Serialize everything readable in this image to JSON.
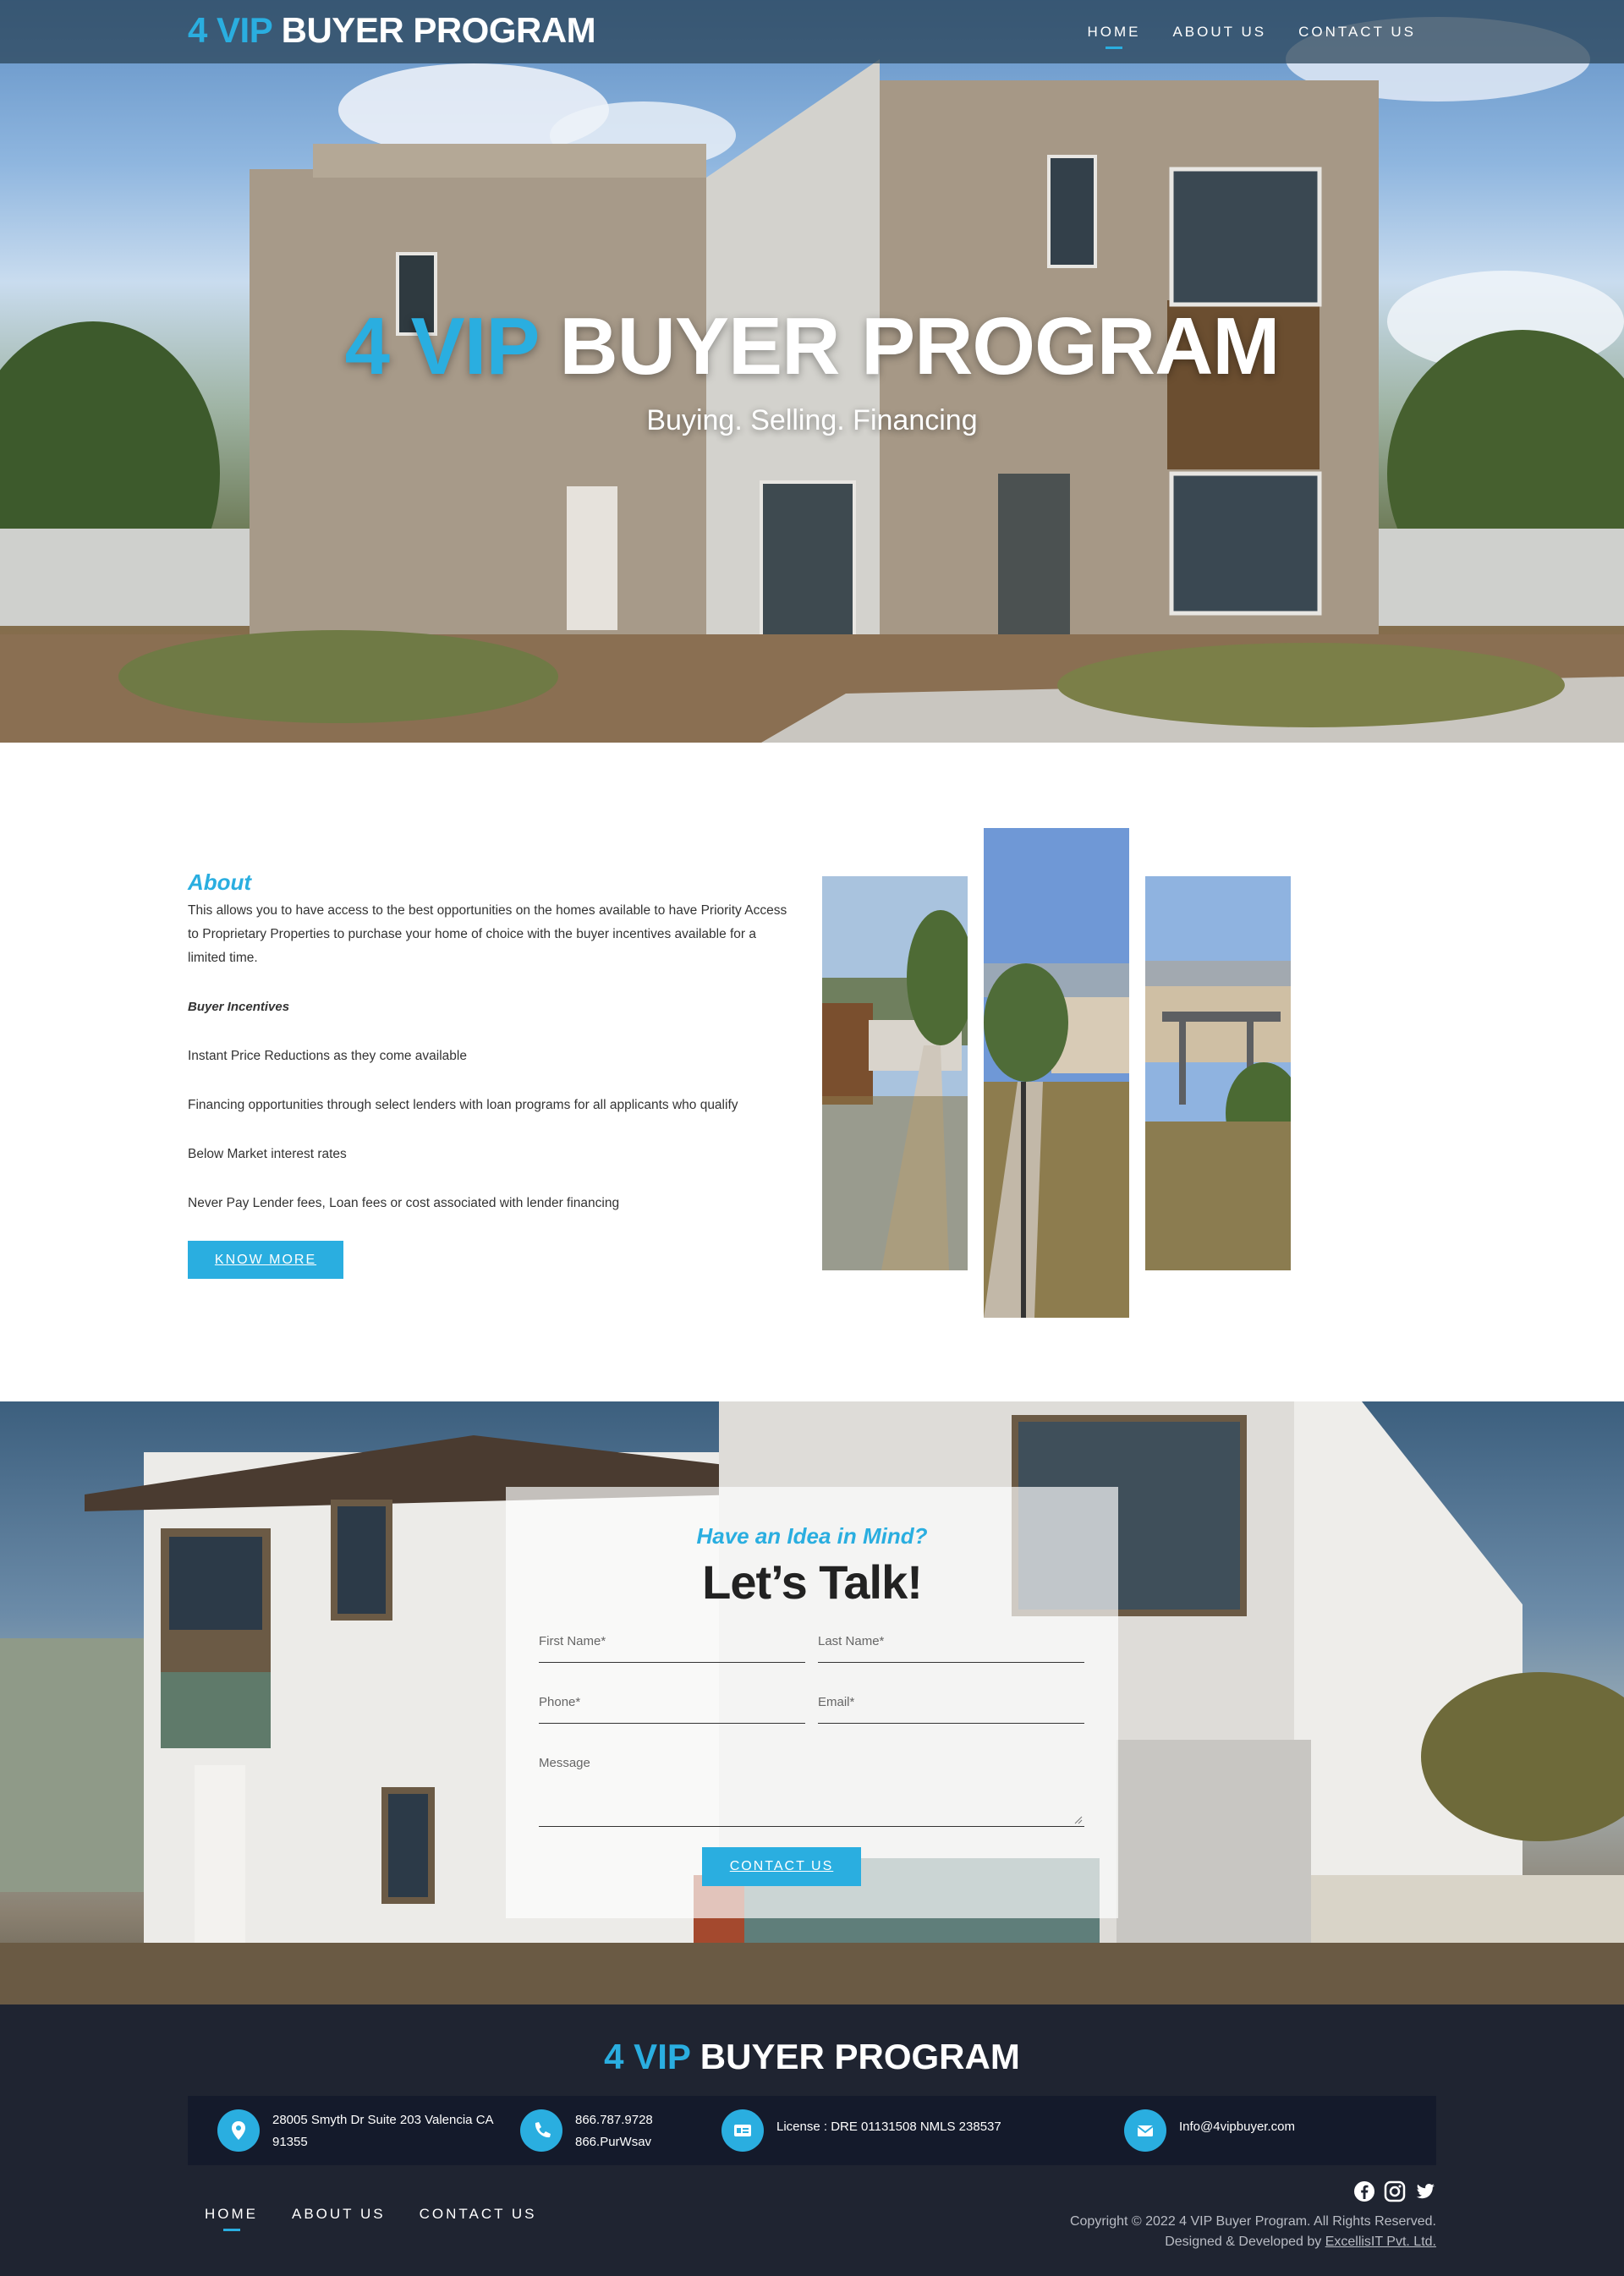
{
  "header": {
    "logo_accent": "4 VIP",
    "logo_text": "BUYER PROGRAM",
    "nav": [
      {
        "label": "HOME",
        "active": true
      },
      {
        "label": "ABOUT US",
        "active": false
      },
      {
        "label": "CONTACT US",
        "active": false
      }
    ]
  },
  "hero": {
    "title_accent": "4 VIP",
    "title_text": "BUYER PROGRAM",
    "subtitle": "Buying. Selling. Financing"
  },
  "about": {
    "heading": "About",
    "intro": "This allows you to have access to the best opportunities on the homes available to have Priority Access to Proprietary Properties to purchase your home of choice with the buyer incentives available for a limited time.",
    "incentives_heading": "Buyer Incentives",
    "incentives": [
      "Instant Price Reductions as they come available",
      "Financing opportunities through select lenders with loan programs for all applicants who qualify",
      "Below Market interest rates",
      "Never Pay Lender fees, Loan fees or cost associated with lender financing"
    ],
    "button_label": "KNOW MORE"
  },
  "contact": {
    "eyebrow": "Have an Idea in Mind?",
    "title": "Let’s Talk!",
    "fields": {
      "first_name": "First Name*",
      "last_name": "Last Name*",
      "phone": "Phone*",
      "email": "Email*",
      "message": "Message"
    },
    "button_label": "CONTACT US"
  },
  "footer": {
    "logo_accent": "4 VIP",
    "logo_text": "BUYER PROGRAM",
    "address": "28005 Smyth Dr Suite 203 Valencia CA 91355",
    "phone_1": "866.787.9728",
    "phone_2": "866.PurWsav",
    "license": "License : DRE 01131508 NMLS 238537",
    "email": "Info@4vipbuyer.com",
    "nav": [
      {
        "label": "HOME",
        "active": true
      },
      {
        "label": "ABOUT US",
        "active": false
      },
      {
        "label": "CONTACT US",
        "active": false
      }
    ],
    "copyright": "Copyright © 2022 4 VIP Buyer Program. All Rights Reserved.",
    "designed_by": "Designed & Developed by",
    "designer": "ExcellisIT Pvt. Ltd."
  },
  "colors": {
    "accent": "#2aaee0",
    "footer_bg": "#1f2431",
    "info_bar_bg": "#141a2b"
  },
  "icons": [
    "map-pin-icon",
    "phone-icon",
    "id-card-icon",
    "mail-icon",
    "facebook-icon",
    "instagram-icon",
    "twitter-icon"
  ]
}
